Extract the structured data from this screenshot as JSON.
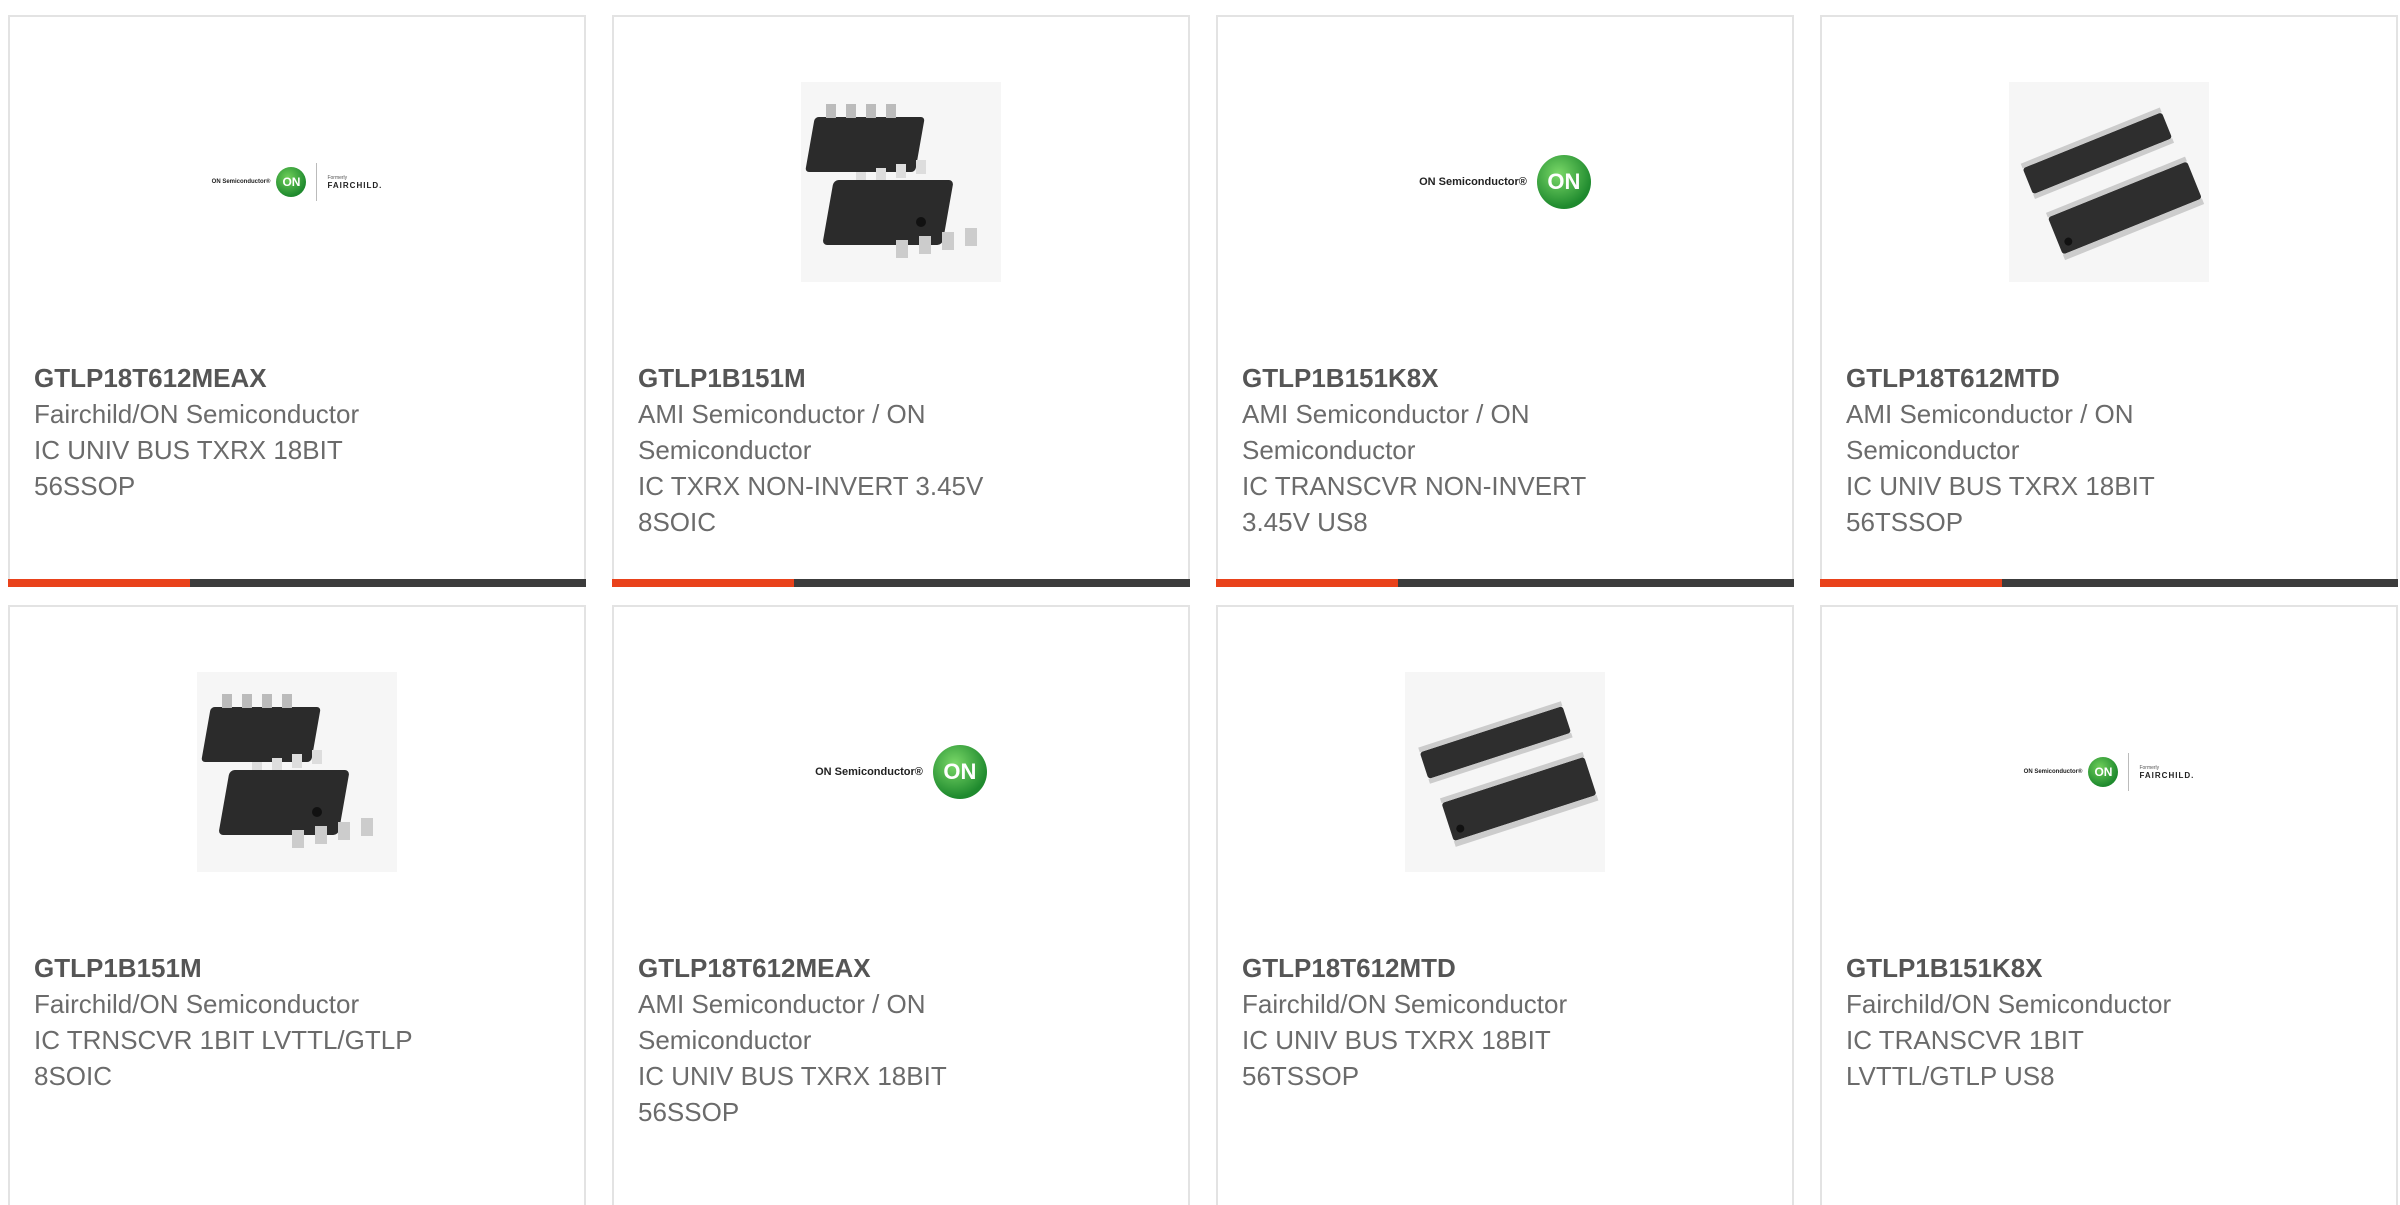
{
  "colors": {
    "accent": "#e9421b",
    "bar_dark": "#3c3c3c",
    "border": "#e3e3e3",
    "text": "#666666"
  },
  "products": [
    {
      "image": "on-fairchild-logo",
      "part": "GTLP18T612MEAX",
      "maker": "Fairchild/ON Semiconductor",
      "desc": "IC UNIV BUS TXRX 18BIT",
      "pkg": "56SSOP"
    },
    {
      "image": "soic8-chip",
      "part": "GTLP1B151M",
      "maker": "AMI Semiconductor / ON Semiconductor",
      "desc": "IC TXRX NON-INVERT 3.45V",
      "pkg": "8SOIC"
    },
    {
      "image": "on-semiconductor-logo",
      "part": "GTLP1B151K8X",
      "maker": "AMI Semiconductor / ON Semiconductor",
      "desc": "IC TRANSCVR NON-INVERT",
      "pkg": "3.45V US8"
    },
    {
      "image": "tssop-chip",
      "part": "GTLP18T612MTD",
      "maker": "AMI Semiconductor / ON Semiconductor",
      "desc": "IC UNIV BUS TXRX 18BIT",
      "pkg": "56TSSOP"
    },
    {
      "image": "soic8-chip",
      "part": "GTLP1B151M",
      "maker": "Fairchild/ON Semiconductor",
      "desc": "IC TRNSCVR 1BIT LVTTL/GTLP",
      "pkg": "8SOIC"
    },
    {
      "image": "on-semiconductor-logo",
      "part": "GTLP18T612MEAX",
      "maker": "AMI Semiconductor / ON Semiconductor",
      "desc": "IC UNIV BUS TXRX 18BIT",
      "pkg": "56SSOP"
    },
    {
      "image": "tssop-chip",
      "part": "GTLP18T612MTD",
      "maker": "Fairchild/ON Semiconductor",
      "desc": "IC UNIV BUS TXRX 18BIT",
      "pkg": "56TSSOP"
    },
    {
      "image": "on-fairchild-logo",
      "part": "GTLP1B151K8X",
      "maker": "Fairchild/ON Semiconductor",
      "desc": "IC TRANSCVR 1BIT",
      "pkg": "LVTTL/GTLP US8"
    }
  ],
  "logo_text": {
    "on_semi": "ON Semiconductor®",
    "on_badge": "ON",
    "formerly": "Formerly",
    "fairchild": "FAIRCHILD."
  }
}
